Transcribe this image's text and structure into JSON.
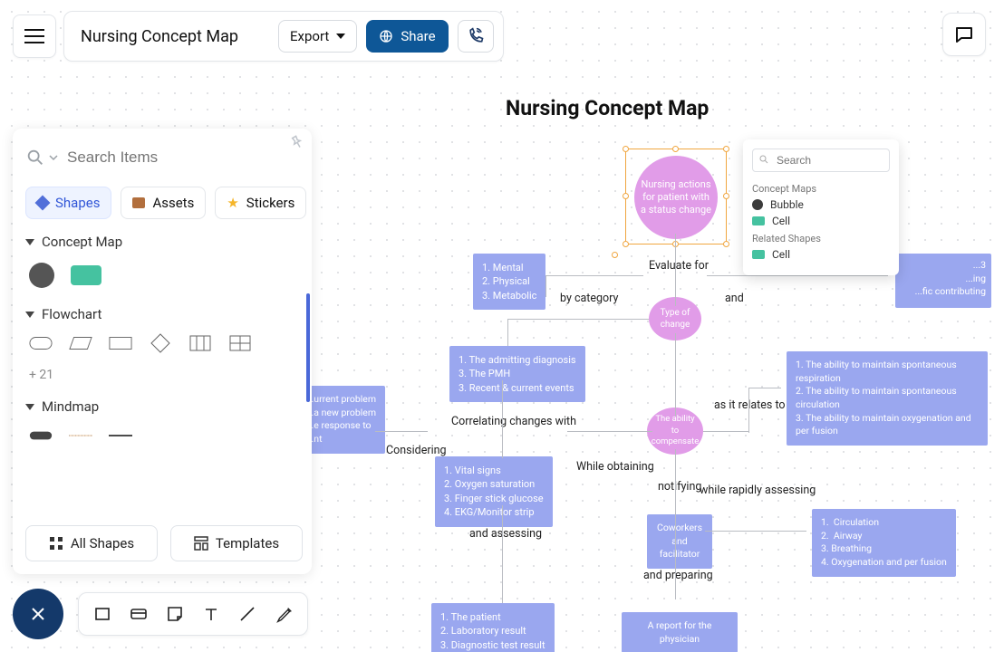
{
  "header": {
    "title": "Nursing Concept Map",
    "export_label": "Export",
    "share_label": "Share"
  },
  "library": {
    "search_placeholder": "Search Items",
    "tabs": {
      "shapes": "Shapes",
      "assets": "Assets",
      "stickers": "Stickers"
    },
    "sections": {
      "concept": "Concept Map",
      "flowchart": "Flowchart",
      "mindmap": "Mindmap"
    },
    "more_count": "+ 21",
    "bottom": {
      "all_shapes": "All Shapes",
      "templates": "Templates"
    }
  },
  "popup": {
    "search_placeholder": "Search",
    "group1": "Concept Maps",
    "bubble": "Bubble",
    "cell1": "Cell",
    "group2": "Related Shapes",
    "cell2": "Cell"
  },
  "diagram": {
    "title": "Nursing Concept Map",
    "nodes": {
      "top": "Nursing actions for patient with a status change",
      "type": "Type of change",
      "ability": "The ability to compensate",
      "coworkers": "Coworkers and facilitator",
      "report": "A report for the physician"
    },
    "boxes": {
      "cat": "1. Mental\n2. Physical\n3. Metabolic",
      "correl": "1. The admitting diagnosis\n3. The PMH\n3. Recent & current events",
      "vitals": "1. Vital signs\n2. Oxygen saturation\n3. Finger stick glucose\n4. EKG/Monitor strip",
      "patient": "1. The patient\n2. Laboratory result\n3. Diagnostic test result",
      "resp": "1.  The ability to maintain spontaneous respiration\n2.  The ability to maintain spontaneous circulation\n3.  The ability to maintain oxygenation and per fusion",
      "circ": "1.  Circulation\n2.  Airway\n3. Breathing\n4. Oxygenation and per fusion",
      "left": "...urrent problem\n...a new problem\n...e response to\n...nt",
      "right_peek": "...3\n...ing\n...fic contributing"
    },
    "labels": {
      "evaluate": "Evaluate for",
      "bycat": "by category",
      "and": "and",
      "correlating": "Correlating changes with",
      "considering": "Considering",
      "whileobt": "While obtaining",
      "notifying": "notifying",
      "asrelates": "as it relates to",
      "rapidly": "while rapidly assessing",
      "andassess": "and assessing",
      "andprep": "and preparing"
    }
  }
}
